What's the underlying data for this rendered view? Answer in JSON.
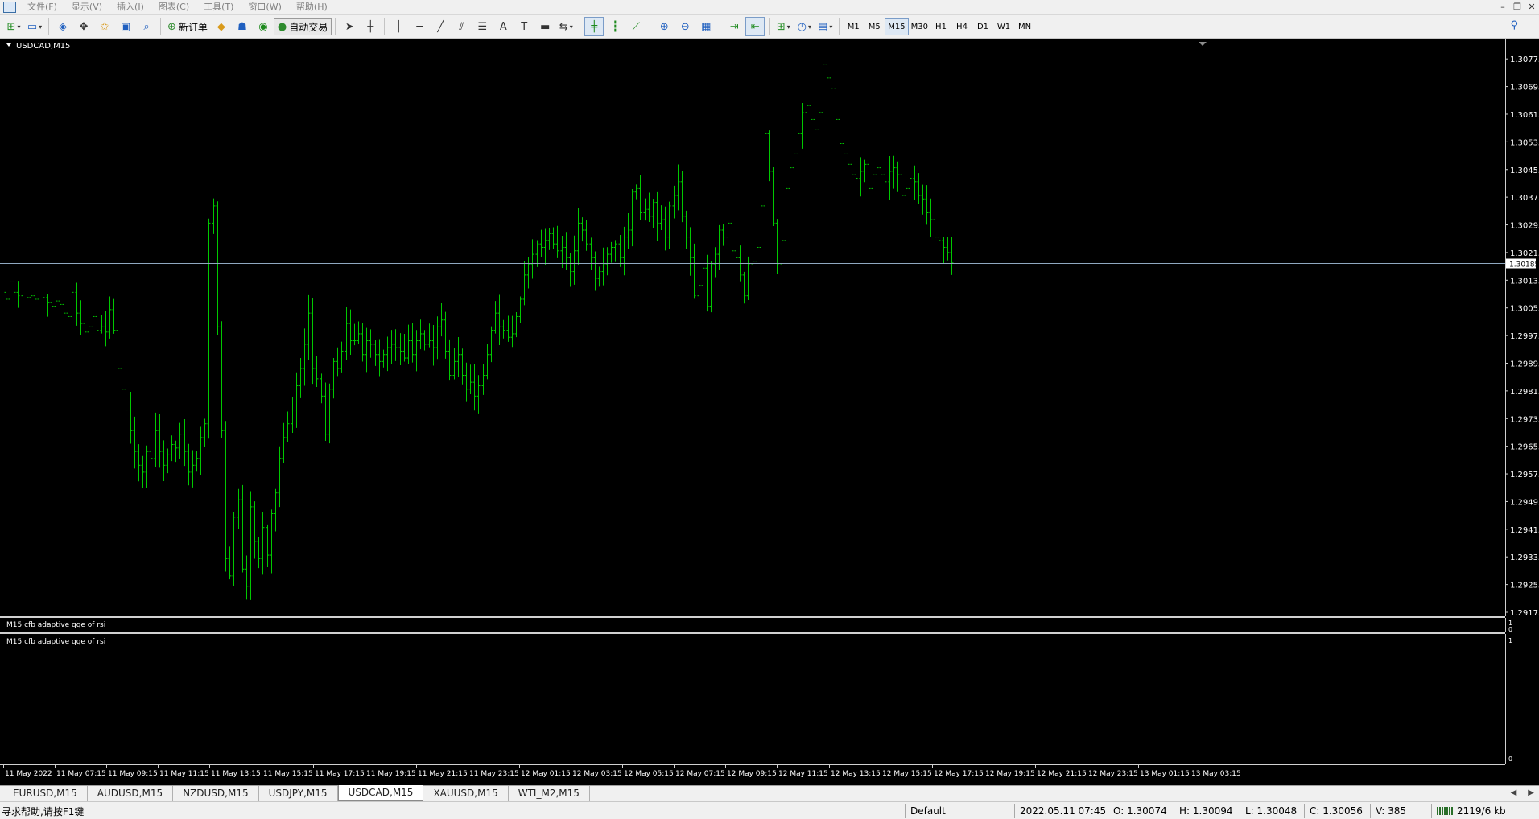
{
  "menu": [
    "文件(F)",
    "显示(V)",
    "插入(I)",
    "图表(C)",
    "工具(T)",
    "窗口(W)",
    "帮助(H)"
  ],
  "toolbar": {
    "new_order": "新订单",
    "auto_trading": "自动交易",
    "timeframes": [
      "M1",
      "M5",
      "M15",
      "M30",
      "H1",
      "H4",
      "D1",
      "W1",
      "MN"
    ],
    "active_timeframe": "M15"
  },
  "chart": {
    "label": "USDCAD,M15",
    "current_price": "1.30185",
    "line_color": "#00c800",
    "background": "#000000",
    "price_labels": [
      "1.30775",
      "1.30695",
      "1.30615",
      "1.30535",
      "1.30455",
      "1.30375",
      "1.30295",
      "1.30215",
      "1.30135",
      "1.30055",
      "1.29975",
      "1.29895",
      "1.29815",
      "1.29735",
      "1.29655",
      "1.29575",
      "1.29495",
      "1.29415",
      "1.29335",
      "1.29255",
      "1.29175"
    ],
    "time_labels": [
      "11 May 2022",
      "11 May 07:15",
      "11 May 09:15",
      "11 May 11:15",
      "11 May 13:15",
      "11 May 15:15",
      "11 May 17:15",
      "11 May 19:15",
      "11 May 21:15",
      "11 May 23:15",
      "12 May 01:15",
      "12 May 03:15",
      "12 May 05:15",
      "12 May 07:15",
      "12 May 09:15",
      "12 May 11:15",
      "12 May 13:15",
      "12 May 15:15",
      "12 May 17:15",
      "12 May 19:15",
      "12 May 21:15",
      "12 May 23:15",
      "13 May 01:15",
      "13 May 03:15"
    ]
  },
  "indicators": [
    {
      "label": "M15  cfb adaptive qqe of rsi",
      "scale_top": "1",
      "scale_bottom": "0"
    },
    {
      "label": "M15  cfb adaptive qqe of rsi",
      "scale_top": "1",
      "scale_bottom": "0"
    }
  ],
  "tabs": [
    "EURUSD,M15",
    "AUDUSD,M15",
    "NZDUSD,M15",
    "USDJPY,M15",
    "USDCAD,M15",
    "XAUUSD,M15",
    "WTI_M2,M15"
  ],
  "active_tab": "USDCAD,M15",
  "status": {
    "help": "寻求帮助,请按F1键",
    "profile": "Default",
    "datetime": "2022.05.11 07:45",
    "open": "O: 1.30074",
    "high": "H: 1.30094",
    "low": "L: 1.30048",
    "close": "C: 1.30056",
    "volume": "V: 385",
    "traffic": "2119/6 kb"
  },
  "chart_data": {
    "type": "ohlc",
    "x_first": "11 May 2022",
    "x_last": "13 May 03:15",
    "ylim": [
      1.29175,
      1.30815
    ],
    "current_price": 1.30185,
    "closes": [
      1.3008,
      1.3013,
      1.301,
      1.3009,
      1.30095,
      1.30085,
      1.3009,
      1.3008,
      1.30095,
      1.30085,
      1.3007,
      1.3006,
      1.30075,
      1.30065,
      1.3004,
      1.3003,
      1.301,
      1.3004,
      1.3001,
      1.29985,
      1.3,
      1.3003,
      1.2999,
      1.3,
      1.29985,
      1.3005,
      1.2999,
      1.2988,
      1.2982,
      1.2976,
      1.297,
      1.2964,
      1.296,
      1.2958,
      1.2964,
      1.2962,
      1.297,
      1.2964,
      1.296,
      1.2963,
      1.2966,
      1.2965,
      1.2969,
      1.2964,
      1.2958,
      1.296,
      1.2962,
      1.2968,
      1.2972,
      1.303,
      1.3035,
      1.3,
      1.297,
      1.2933,
      1.2928,
      1.2945,
      1.295,
      1.293,
      1.2925,
      1.2948,
      1.2938,
      1.2933,
      1.2942,
      1.2934,
      1.2946,
      1.2952,
      1.2962,
      1.2968,
      1.2972,
      1.2976,
      1.2983,
      1.2988,
      1.2995,
      1.3004,
      1.2988,
      1.2985,
      1.298,
      1.2969,
      1.2982,
      1.299,
      1.2988,
      1.2993,
      1.3001,
      1.2996,
      1.2996,
      1.2998,
      1.2992,
      1.2996,
      1.2995,
      1.2992,
      1.299,
      1.2992,
      1.2994,
      1.2995,
      1.2994,
      1.2993,
      1.2991,
      1.2996,
      1.2992,
      1.2996,
      1.2998,
      1.2995,
      1.2996,
      1.2994,
      1.3,
      1.3002,
      1.2993,
      1.2986,
      1.299,
      1.2992,
      1.2986,
      1.2982,
      1.2984,
      1.298,
      1.2983,
      1.2986,
      1.2992,
      1.2999,
      1.3004,
      1.3,
      1.2999,
      1.2997,
      1.2998,
      1.3003,
      1.3008,
      1.3015,
      1.3018,
      1.3021,
      1.3024,
      1.3023,
      1.3025,
      1.3027,
      1.3024,
      1.3022,
      1.3023,
      1.302,
      1.3016,
      1.3022,
      1.303,
      1.3028,
      1.3024,
      1.302,
      1.3014,
      1.3016,
      1.3018,
      1.3021,
      1.3023,
      1.3024,
      1.302,
      1.3026,
      1.3028,
      1.3039,
      1.304,
      1.3033,
      1.3034,
      1.3032,
      1.3036,
      1.303,
      1.3031,
      1.3026,
      1.3035,
      1.3038,
      1.3042,
      1.3032,
      1.3026,
      1.302,
      1.3009,
      1.3012,
      1.3017,
      1.3006,
      1.3018,
      1.3021,
      1.3028,
      1.3026,
      1.303,
      1.3022,
      1.302,
      1.3015,
      1.3009,
      1.3018,
      1.3019,
      1.3023,
      1.3035,
      1.3056,
      1.3045,
      1.303,
      1.3018,
      1.3025,
      1.304,
      1.3046,
      1.305,
      1.3056,
      1.3062,
      1.3064,
      1.306,
      1.3057,
      1.3062,
      1.3076,
      1.3072,
      1.3069,
      1.306,
      1.3053,
      1.305,
      1.3047,
      1.3044,
      1.3043,
      1.3045,
      1.3047,
      1.304,
      1.3044,
      1.3046,
      1.3044,
      1.3042,
      1.3045,
      1.3046,
      1.3044,
      1.3038,
      1.304,
      1.3043,
      1.3042,
      1.3038,
      1.3037,
      1.3033,
      1.3031,
      1.3026,
      1.3025,
      1.3023,
      1.30215,
      1.30185
    ]
  }
}
